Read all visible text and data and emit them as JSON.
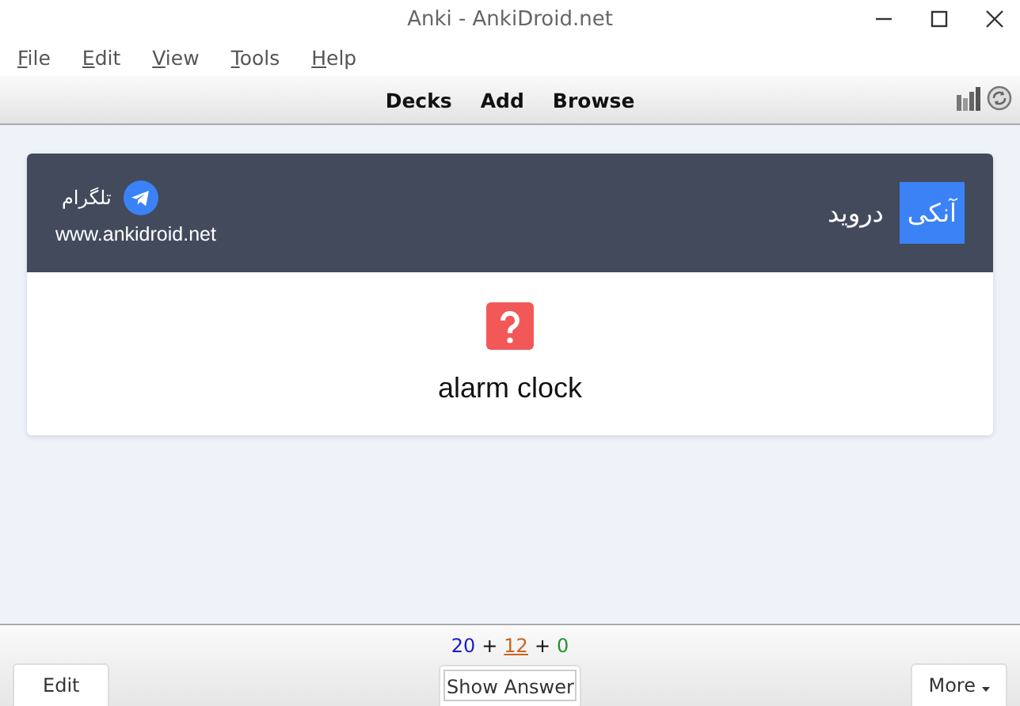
{
  "window": {
    "title": "Anki - AnkiDroid.net"
  },
  "menu": [
    "File",
    "Edit",
    "View",
    "Tools",
    "Help"
  ],
  "toolbar": {
    "links": [
      "Decks",
      "Add",
      "Browse"
    ]
  },
  "card": {
    "banner": {
      "app_word": "آنکی",
      "app_name": "دروید",
      "telegram": "تلگرام",
      "website": "www.ankidroid.net"
    },
    "question": "alarm clock"
  },
  "counts": [
    {
      "value": "20",
      "color": "#1a1ac8",
      "selected": false
    },
    {
      "value": "12",
      "color": "#c8641e",
      "selected": true
    },
    {
      "value": "0",
      "color": "#1e9628",
      "selected": false
    }
  ],
  "count_separators": [
    "+",
    "+"
  ],
  "buttons": {
    "edit": "Edit",
    "show_answer": "Show Answer",
    "more": "More"
  }
}
